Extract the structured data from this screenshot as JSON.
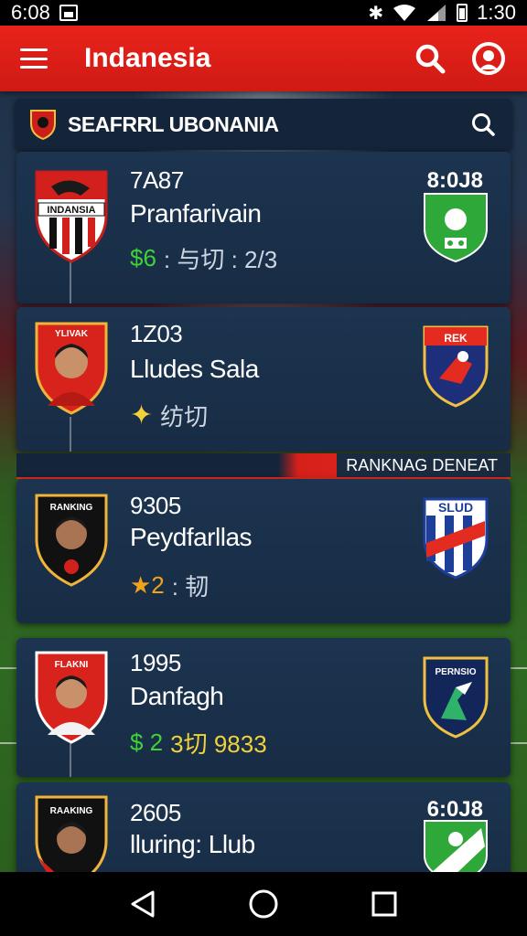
{
  "status_bar": {
    "time": "6:08",
    "clock": "1:30",
    "icons": [
      "image-icon",
      "bluetooth-icon",
      "wifi-icon",
      "signal-icon",
      "battery-icon"
    ]
  },
  "app_bar": {
    "title": "Indanesia",
    "accent": "#e8231b",
    "icons": [
      "menu-icon",
      "search-icon",
      "profile-icon"
    ]
  },
  "search_header": {
    "title": "SEAFRRL UBONANIA",
    "icon": "search-icon"
  },
  "banner": {
    "label": "RANKNAG DENEAT"
  },
  "players": [
    {
      "badge_text": "INDANSIA",
      "number": "7A87",
      "name": "Pranfarivain",
      "stat_a": "$6",
      "stat_b": ": 与切 : 2/3",
      "time": "8:0J8",
      "club_icon": "green-shield-icon"
    },
    {
      "badge_text": "YLIVAK",
      "number": "1Z03",
      "name": "Lludes Sala",
      "stat_a": "",
      "stat_b": "纺切",
      "time": "",
      "club_icon": "navy-red-shield-icon"
    },
    {
      "badge_text": "RANKING",
      "number": "9305",
      "name": "Peydfarllas",
      "stat_a": "★2",
      "stat_b": ": 韧",
      "time": "",
      "club_icon": "striped-shield-icon",
      "club_text": "SLUD"
    },
    {
      "badge_text": "FLAKNI",
      "number": "1995",
      "name": "Danfagh",
      "stat_a": "$ 2",
      "stat_b": "3切 9833",
      "time": "",
      "club_icon": "navy-shield-icon",
      "club_text": "PERNSIO"
    },
    {
      "badge_text": "RAAKING",
      "number": "2605",
      "name": "lluring: Llub",
      "stat_a": "",
      "stat_b": "",
      "time": "6:0J8",
      "club_icon": "green-white-shield-icon"
    }
  ],
  "nav_bar": {
    "icons": [
      "back-icon",
      "home-icon",
      "recents-icon"
    ]
  }
}
